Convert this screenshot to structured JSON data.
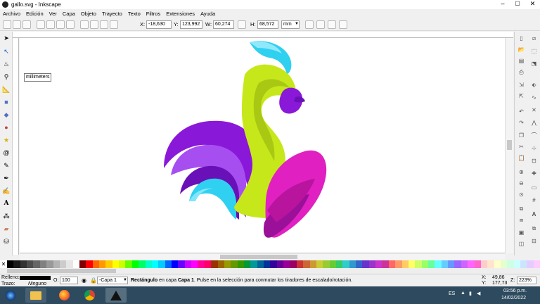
{
  "window": {
    "title": "gallo.svg - Inkscape"
  },
  "menu": [
    "Archivo",
    "Edición",
    "Ver",
    "Capa",
    "Objeto",
    "Trayecto",
    "Texto",
    "Filtros",
    "Extensiones",
    "Ayuda"
  ],
  "toolcontrols": {
    "x_label": "X:",
    "x_value": "-18,630",
    "y_label": "Y:",
    "y_value": "123,992",
    "w_label": "W:",
    "w_value": "60,274",
    "h_label": "H:",
    "h_value": "68,572",
    "unit": "mm"
  },
  "tooltip": "millimeters",
  "status": {
    "fill_label": "Relleno:",
    "stroke_label": "Trazo:",
    "stroke_value": "Ninguno",
    "opacity_label": "O:",
    "opacity_value": "100",
    "layer": "-Capa 1",
    "message_bold": "Rectángulo",
    "message_mid": " en capa ",
    "message_layer": "Capa 1",
    "message_rest": ". Pulse en la selección para conmutar los tiradores de escalado/rotación.",
    "cursor_x_label": "X:",
    "cursor_x": "49,86",
    "cursor_y_label": "Y:",
    "cursor_y": "177,73",
    "zoom_label": "Z:",
    "zoom": "223%"
  },
  "taskbar": {
    "lang": "ES",
    "time": "03:56 p.m.",
    "date": "14/02/2022"
  },
  "colors": {
    "magenta": "#e020c0",
    "purple": "#8a18d8",
    "lime": "#c6e81a",
    "cyan": "#2fd0f0"
  },
  "palette": [
    "#000000",
    "#1a1a1a",
    "#333333",
    "#4d4d4d",
    "#666666",
    "#808080",
    "#999999",
    "#b3b3b3",
    "#cccccc",
    "#e6e6e6",
    "#ffffff",
    "#800000",
    "#ff0000",
    "#ff6600",
    "#ff9900",
    "#ffcc00",
    "#ffff00",
    "#ccff00",
    "#66ff00",
    "#00ff00",
    "#00ff66",
    "#00ffcc",
    "#00ffff",
    "#00ccff",
    "#0066ff",
    "#0000ff",
    "#6600ff",
    "#cc00ff",
    "#ff00ff",
    "#ff0099",
    "#ff0066",
    "#993300",
    "#996600",
    "#999900",
    "#669900",
    "#339900",
    "#009933",
    "#009999",
    "#006699",
    "#003399",
    "#330099",
    "#660099",
    "#990099",
    "#990066",
    "#cc3333",
    "#cc6633",
    "#cc9933",
    "#cccc33",
    "#99cc33",
    "#66cc33",
    "#33cc66",
    "#33cccc",
    "#3399cc",
    "#3366cc",
    "#6633cc",
    "#9933cc",
    "#cc33cc",
    "#cc3399",
    "#ff6666",
    "#ff9966",
    "#ffcc66",
    "#ffff66",
    "#ccff66",
    "#99ff66",
    "#66ff99",
    "#66ffff",
    "#66ccff",
    "#6699ff",
    "#9966ff",
    "#cc66ff",
    "#ff66ff",
    "#ff66cc",
    "#ffcccc",
    "#ffe5cc",
    "#ffffcc",
    "#e5ffcc",
    "#ccffe5",
    "#ccffff",
    "#cce5ff",
    "#e5ccff",
    "#ffccff"
  ]
}
